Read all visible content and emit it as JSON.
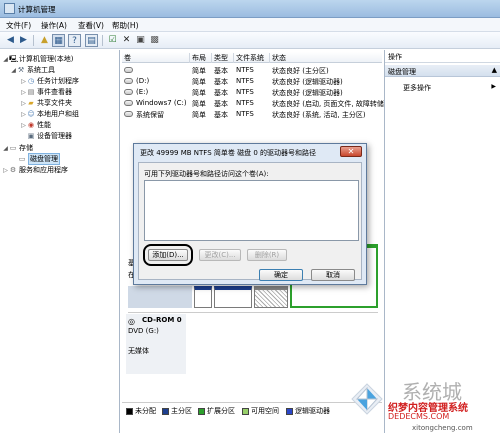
{
  "window": {
    "title": "计算机管理"
  },
  "menu": [
    "文件(F)",
    "操作(A)",
    "查看(V)",
    "帮助(H)"
  ],
  "tree": {
    "root": "计算机管理(本地)",
    "system_tools": "系统工具",
    "task_scheduler": "任务计划程序",
    "event_viewer": "事件查看器",
    "shared_folders": "共享文件夹",
    "local_users": "本地用户和组",
    "performance": "性能",
    "device_manager": "设备管理器",
    "storage": "存储",
    "disk_management": "磁盘管理",
    "services_apps": "服务和应用程序"
  },
  "volume_table": {
    "headers": [
      "卷",
      "布局",
      "类型",
      "文件系统",
      "状态"
    ],
    "rows": [
      {
        "vol": "",
        "layout": "简单",
        "type": "基本",
        "fs": "NTFS",
        "status": "状态良好 (主分区)"
      },
      {
        "vol": "(D:)",
        "layout": "简单",
        "type": "基本",
        "fs": "NTFS",
        "status": "状态良好 (逻辑驱动器)"
      },
      {
        "vol": "(E:)",
        "layout": "简单",
        "type": "基本",
        "fs": "NTFS",
        "status": "状态良好 (逻辑驱动器)"
      },
      {
        "vol": "Windows7 (C:)",
        "layout": "简单",
        "type": "基本",
        "fs": "NTFS",
        "status": "状态良好 (启动, 页面文件, 故障转储, 主分区)"
      },
      {
        "vol": "系统保留",
        "layout": "简单",
        "type": "基本",
        "fs": "NTFS",
        "status": "状态良好 (系统, 活动, 主分区)"
      }
    ]
  },
  "actions": {
    "header": "操作",
    "section": "磁盘管理",
    "more": "更多操作"
  },
  "disks": {
    "disk0_partial": "基",
    "disk0_partial2": "在",
    "cdrom_label": "CD-ROM 0",
    "cdrom_drive": "DVD (G:)",
    "cdrom_status": "无媒体"
  },
  "legend": [
    {
      "label": "未分配",
      "color": "#000000"
    },
    {
      "label": "主分区",
      "color": "#1d3f8f"
    },
    {
      "label": "扩展分区",
      "color": "#2ca02c"
    },
    {
      "label": "可用空间",
      "color": "#98d06a"
    },
    {
      "label": "逻辑驱动器",
      "color": "#2b47c9"
    }
  ],
  "dialog": {
    "title": "更改 49999 MB NTFS 简单卷 磁盘 0 的驱动器号和路径",
    "prompt": "可用下列驱动器号和路径访问这个卷(A):",
    "add": "添加(D)...",
    "change": "更改(C)...",
    "delete": "删除(R)",
    "ok": "确定",
    "cancel": "取消",
    "close_glyph": "✕"
  },
  "watermark": {
    "brand": "系统城",
    "site_cn": "织梦内容管理系统",
    "site_en": "DEDECMS.COM",
    "url": "xitongcheng.com"
  },
  "icons": {
    "back": "back-arrow-icon",
    "forward": "forward-arrow-icon",
    "colors": {
      "accent": "#2d5a8c",
      "selection": "#cde4f7"
    }
  }
}
